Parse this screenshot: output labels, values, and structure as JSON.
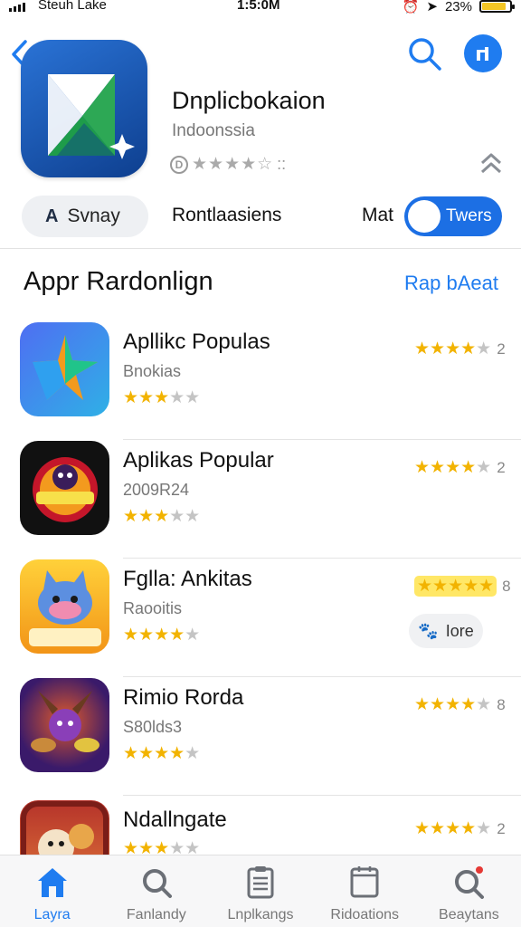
{
  "status_bar": {
    "carrier": "Steuh Lake",
    "time": "1:5:0M",
    "battery_text": "23%",
    "battery_level": 0.85,
    "battery_color": "#f3c625"
  },
  "header": {
    "app_name": "Dnplicbokaion",
    "app_subtitle": "Indoonssia",
    "rating_badge": "D",
    "rating_stars": "★★★★☆",
    "rating_suffix": "::"
  },
  "segment": {
    "chip_icon": "A",
    "chip_label": "Svnay",
    "middle_label": "Rontlaasiens",
    "mat_label": "Mat",
    "toggle_label": "Twers"
  },
  "section": {
    "title": "Appr Rardonlign",
    "see_all": "Rap bAeat"
  },
  "apps": [
    {
      "title": "Apllikc Populas",
      "subtitle": "Bnokias",
      "stars_small": 3,
      "stars_right": 4,
      "count": "2",
      "highlight": false
    },
    {
      "title": "Aplikas Popular",
      "subtitle": "2009R24",
      "stars_small": 3,
      "stars_right": 4,
      "count": "2",
      "highlight": false
    },
    {
      "title": "Fglla: Ankitas",
      "subtitle": "Raooitis",
      "stars_small": 4,
      "stars_right": 5,
      "count": "8",
      "highlight": true,
      "pill_label": "Iore"
    },
    {
      "title": "Rimio Rorda",
      "subtitle": "S80lds3",
      "stars_small": 4,
      "stars_right": 4,
      "count": "8",
      "highlight": false
    },
    {
      "title": "Ndallngate",
      "subtitle": "",
      "stars_small": 3,
      "stars_right": 4,
      "count": "2",
      "highlight": false
    }
  ],
  "tabs": [
    {
      "label": "Layra",
      "icon": "home-icon",
      "active": true
    },
    {
      "label": "Fanlandy",
      "icon": "search-icon",
      "active": false
    },
    {
      "label": "Lnplkangs",
      "icon": "list-icon",
      "active": false
    },
    {
      "label": "Ridoations",
      "icon": "tablet-icon",
      "active": false
    },
    {
      "label": "Beaytans",
      "icon": "search-badge-icon",
      "active": false
    }
  ],
  "colors": {
    "accent": "#1f7cf0",
    "star": "#f2b300",
    "toggle": "#1c6fe4"
  }
}
